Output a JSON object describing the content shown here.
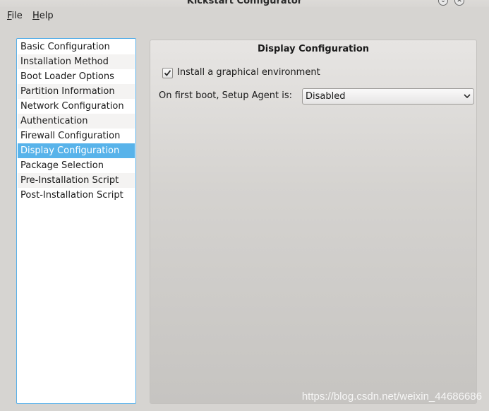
{
  "window": {
    "title": "Kickstart Configurator",
    "controls": [
      "chevron-down-icon",
      "close-icon"
    ]
  },
  "menubar": {
    "file": {
      "mnemonic": "F",
      "rest": "ile"
    },
    "help": {
      "mnemonic": "H",
      "rest": "elp"
    }
  },
  "nav": {
    "items": [
      {
        "label": "Basic Configuration"
      },
      {
        "label": "Installation Method"
      },
      {
        "label": "Boot Loader Options"
      },
      {
        "label": "Partition Information"
      },
      {
        "label": "Network Configuration"
      },
      {
        "label": "Authentication"
      },
      {
        "label": "Firewall Configuration"
      },
      {
        "label": "Display Configuration"
      },
      {
        "label": "Package Selection"
      },
      {
        "label": "Pre-Installation Script"
      },
      {
        "label": "Post-Installation Script"
      }
    ],
    "selected": "Display Configuration"
  },
  "display": {
    "title": "Display Configuration",
    "install_graphical": {
      "label": "Install a graphical environment",
      "checked": true
    },
    "setup_agent": {
      "label": "On first boot, Setup Agent is:",
      "value": "Disabled"
    }
  },
  "watermark": "https://blog.csdn.net/weixin_44686686",
  "colors": {
    "selection": "#58b3ea",
    "focus_border": "#5ab0e8",
    "window_bg": "#d6d4d1"
  }
}
